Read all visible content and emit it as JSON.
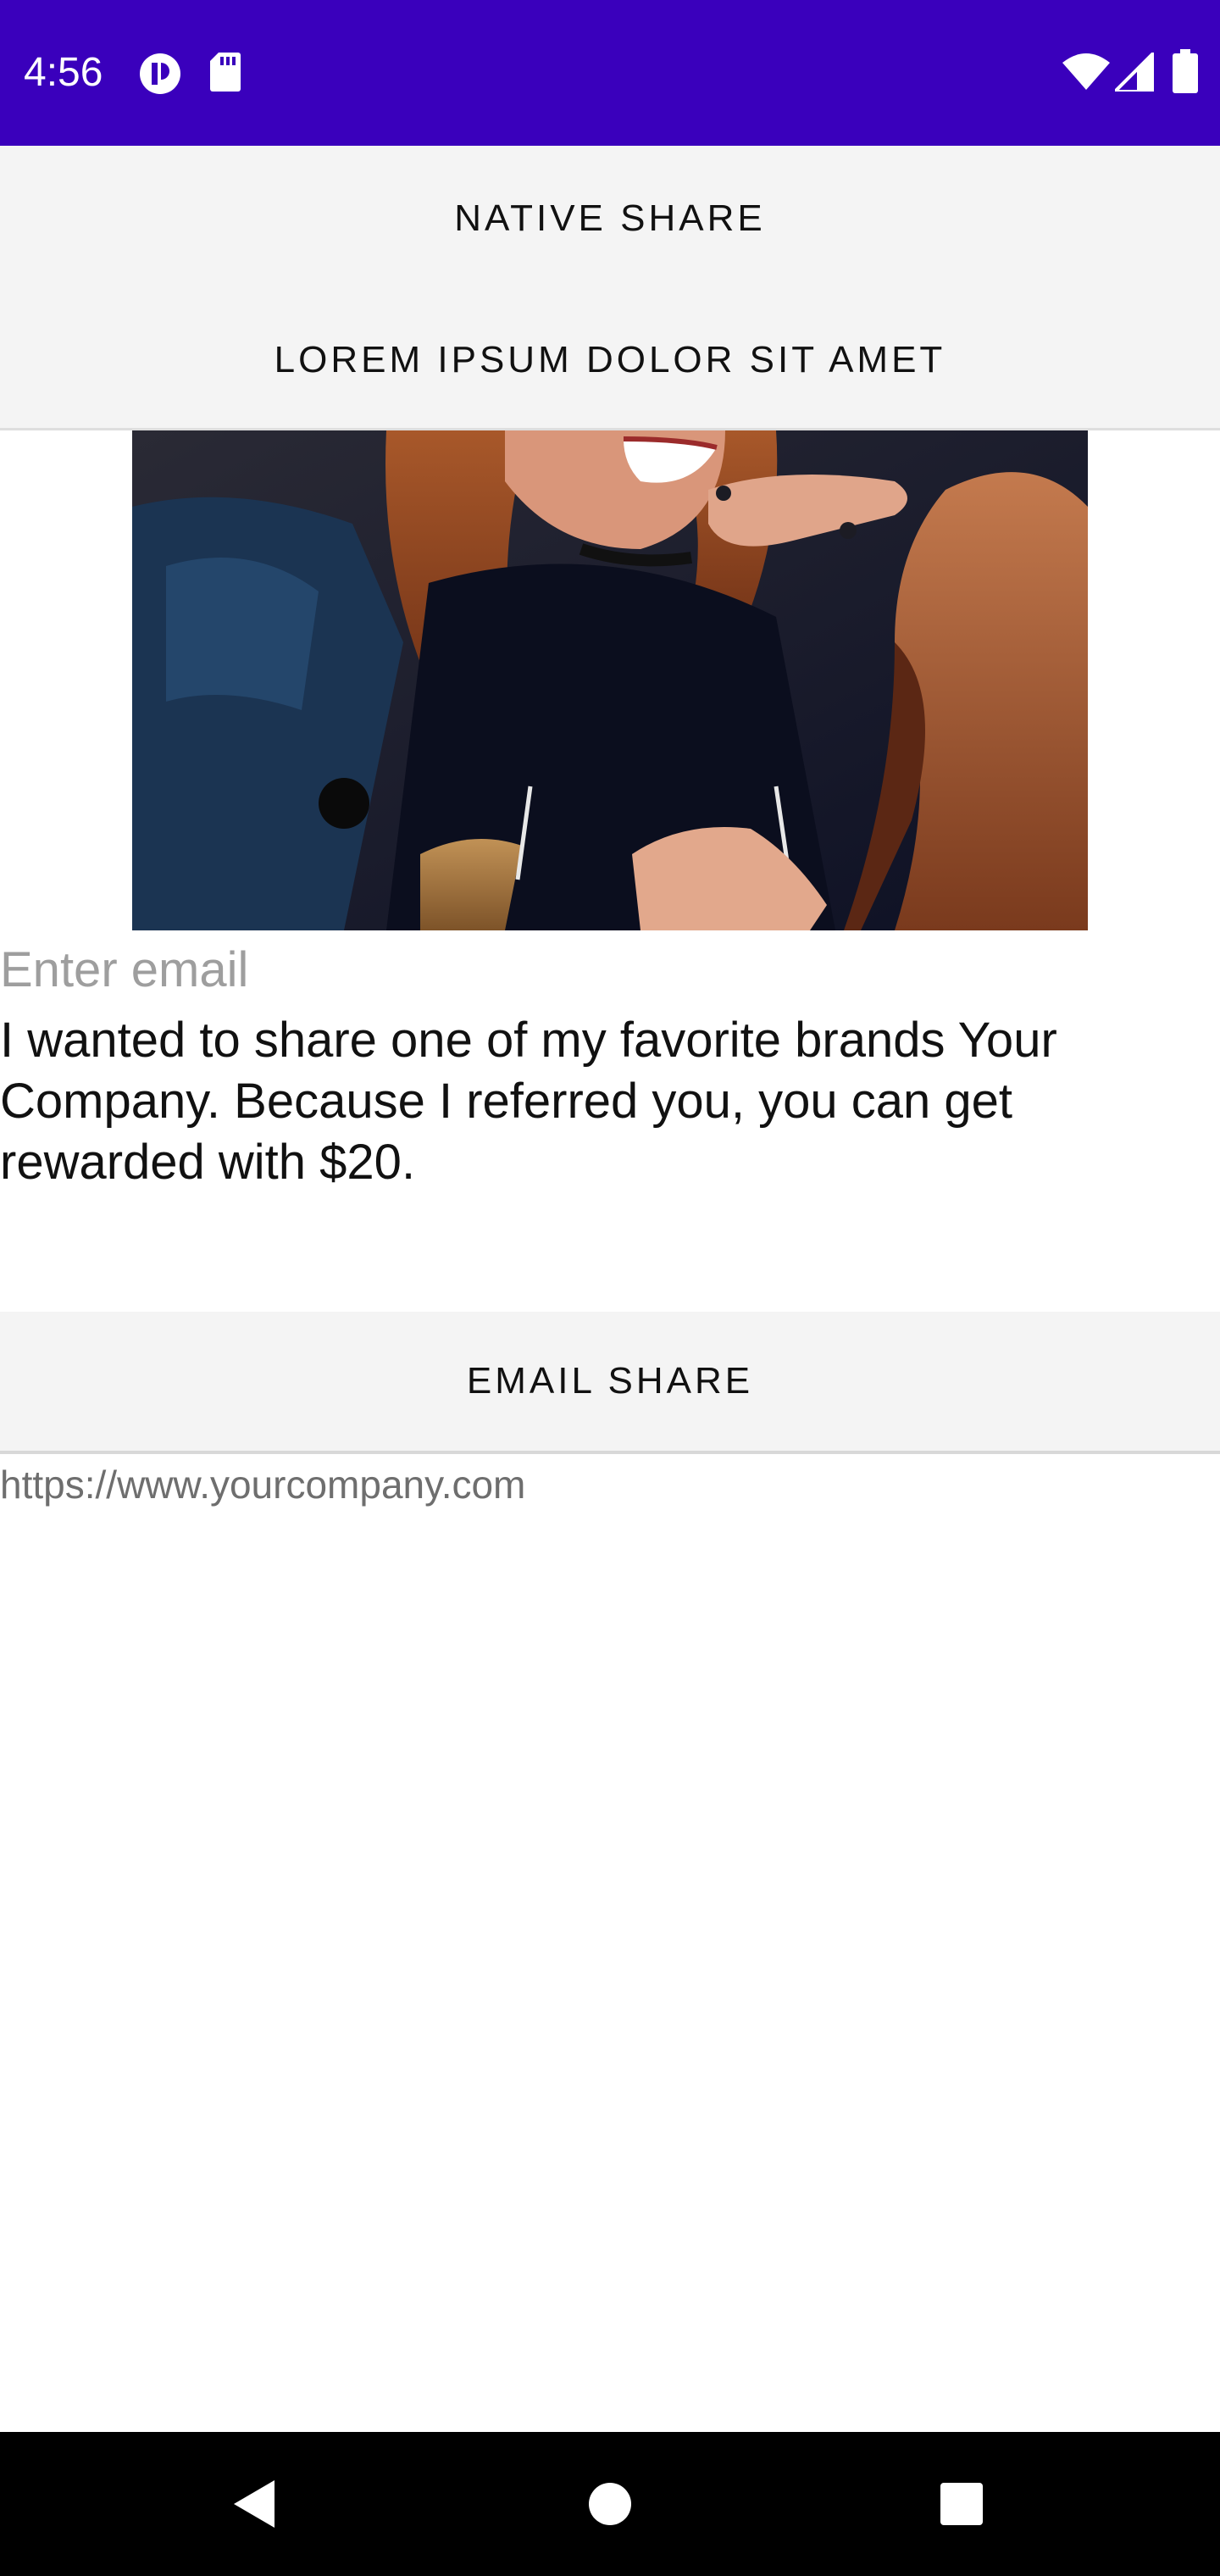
{
  "status_bar": {
    "time": "4:56",
    "background_color": "#3a00bc",
    "left_icons": [
      "app-notification-icon",
      "sd-card-icon"
    ],
    "right_icons": [
      "wifi-icon",
      "cell-signal-icon",
      "battery-icon"
    ]
  },
  "buttons": {
    "native_share": "NATIVE SHARE",
    "lorem": "LOREM IPSUM DOLOR SIT AMET",
    "email_share": "EMAIL SHARE"
  },
  "hero_image": {
    "description_icon": "photo-image"
  },
  "email_field": {
    "value": "",
    "placeholder": "Enter email"
  },
  "message": "I wanted to share one of my favorite brands Your Company. Because I referred you, you can get rewarded with $20.",
  "url": "https://www.yourcompany.com",
  "nav_bar": {
    "icons": [
      "back-icon",
      "home-icon",
      "recents-icon"
    ]
  }
}
